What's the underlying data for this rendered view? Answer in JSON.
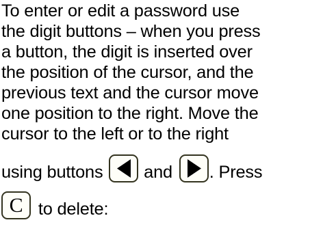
{
  "text": {
    "line1": "To enter or edit a password use",
    "line2": "the digit buttons – when you press",
    "line3": "a button, the digit is inserted over",
    "line4": "the position of the cursor, and the",
    "line5": "previous text and the cursor move",
    "line6": "one position to the right. Move the",
    "line7": "cursor to the left or to the right",
    "line8_before": "using buttons ",
    "line8_middle": " and ",
    "line8_after": ". Press",
    "line9_after": " to delete:"
  },
  "buttons": {
    "left": {
      "icon": "triangle-left-icon"
    },
    "right": {
      "icon": "triangle-right-icon"
    },
    "clear": {
      "label": "C"
    }
  },
  "colors": {
    "text": "#000000",
    "button_border": "#33331f",
    "button_fill": "#fefef8",
    "arrow": "#000000"
  }
}
